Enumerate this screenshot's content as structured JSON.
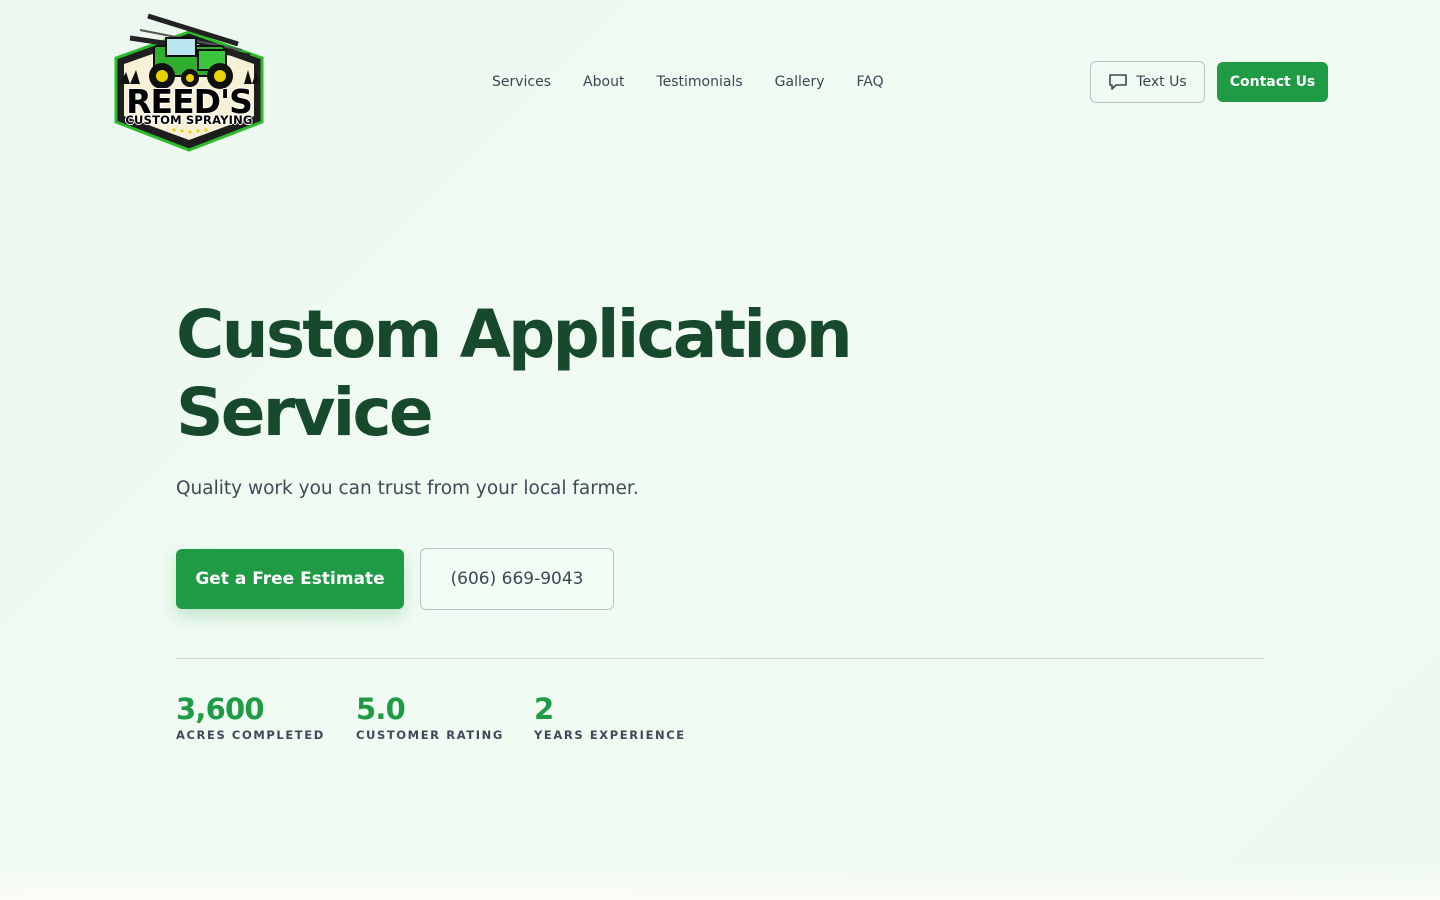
{
  "header": {
    "logo": {
      "brand": "REED'S",
      "tagline": "CUSTOM SPRAYING"
    },
    "nav": [
      {
        "label": "Services"
      },
      {
        "label": "About"
      },
      {
        "label": "Testimonials"
      },
      {
        "label": "Gallery"
      },
      {
        "label": "FAQ"
      }
    ],
    "text_us_label": "Text Us",
    "contact_label": "Contact Us"
  },
  "hero": {
    "title_line1": "Custom Application",
    "title_line2": "Service",
    "subtitle": "Quality work you can trust from your local farmer.",
    "primary_cta": "Get a Free Estimate",
    "phone_cta": "(606) 669-9043"
  },
  "stats": [
    {
      "value": "3,600",
      "label": "ACRES COMPLETED"
    },
    {
      "value": "5.0",
      "label": "CUSTOMER RATING"
    },
    {
      "value": "2",
      "label": "YEARS EXPERIENCE"
    }
  ],
  "colors": {
    "brand_green": "#1f9b45",
    "heading_green": "#17492c",
    "background": "#eefaf0"
  },
  "icons": {
    "text_us": "chat-bubble-icon"
  }
}
